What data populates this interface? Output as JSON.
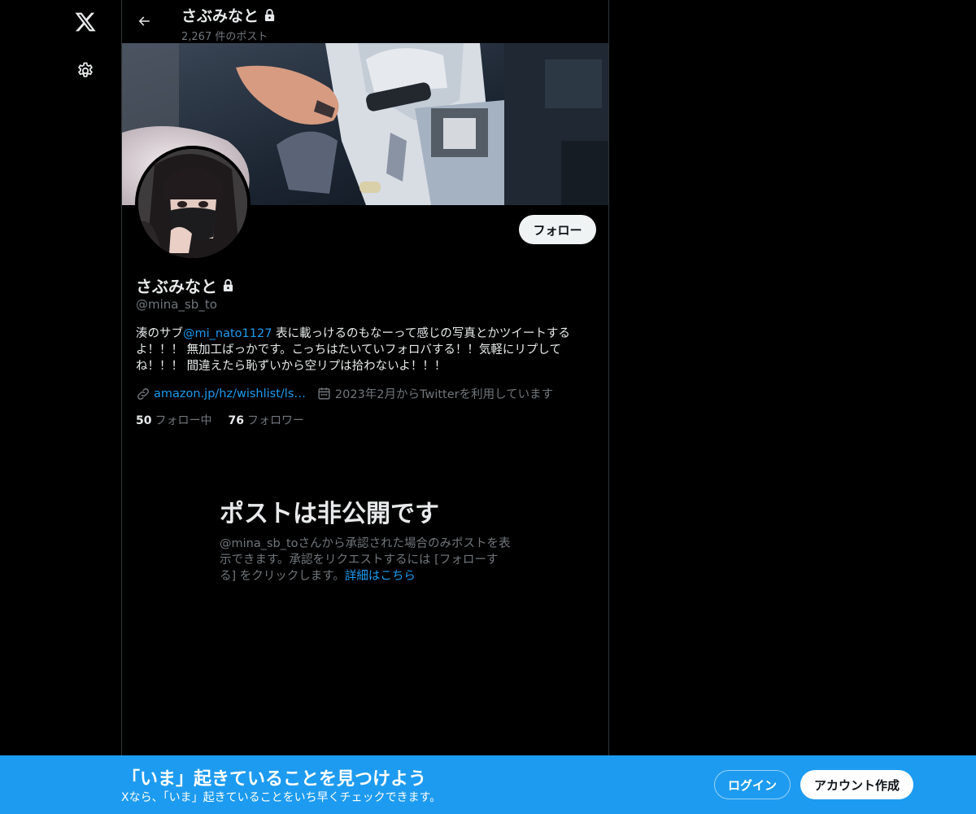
{
  "nav": {
    "logo_icon": "x-logo-icon",
    "settings_icon": "gear-icon"
  },
  "topbar": {
    "name": "さぶみなと",
    "post_count": "2,267 件のポスト"
  },
  "profile": {
    "name": "さぶみなと",
    "handle": "@mina_sb_to",
    "follow_label": "フォロー",
    "bio": {
      "pre": "湊のサブ",
      "mention": "@mi_nato1127",
      "post": " 表に載っけるのもなーって感じの写真とかツイートするよ！！！ 無加工ばっかです。こっちはたいていフォロバする！！気軽にリプしてね！！！ 間違えたら恥ずいから空リプは拾わないよ！！！"
    },
    "link": "amazon.jp/hz/wishlist/ls…",
    "joined": "2023年2月からTwitterを利用しています",
    "following_count": "50",
    "following_label": "フォロー中",
    "followers_count": "76",
    "followers_label": "フォロワー"
  },
  "private": {
    "title": "ポストは非公開です",
    "desc": "@mina_sb_toさんから承認された場合のみポストを表示できます。承認をリクエストするには [フォローする] をクリックします。",
    "learn_more": "詳細はこちら"
  },
  "bottom": {
    "title": "「いま」起きていることを見つけよう",
    "subtitle": "Xなら、「いま」起きていることをいち早くチェックできます。",
    "login": "ログイン",
    "signup": "アカウント作成"
  },
  "colors": {
    "accent": "#1d9bf0",
    "background": "#000000",
    "text": "#e7e9ea",
    "muted": "#71767b"
  }
}
